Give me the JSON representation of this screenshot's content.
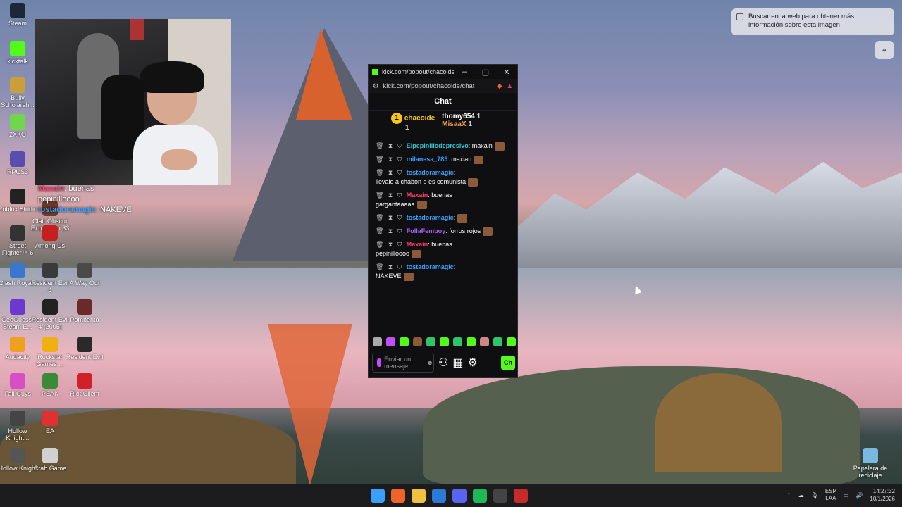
{
  "desktop": {
    "icons": [
      {
        "name": "steam-icon",
        "label": "Steam",
        "color": "#1b2838"
      },
      {
        "name": "kicktalk-icon",
        "label": "kicktalk",
        "color": "#53fc18"
      },
      {
        "name": "bully-icon",
        "label": "Bully Scholarsh...",
        "color": "#c8a03a"
      },
      {
        "name": "2xko-icon",
        "label": "2XKO",
        "color": "#6fd84a"
      },
      {
        "name": "rpcs3-icon",
        "label": "RPCS3",
        "color": "#5b4db0"
      },
      {
        "name": "roblox-studio-icon",
        "label": "Roblox Studio",
        "color": "#222"
      },
      {
        "name": "street-fighter-icon",
        "label": "Street Fighter™ 6",
        "color": "#333"
      },
      {
        "name": "clash-royale-icon",
        "label": "Clash Royale",
        "color": "#3a78d0"
      },
      {
        "name": "geoguessr-icon",
        "label": "GeoGuessr Steam E...",
        "color": "#6a3ad0"
      },
      {
        "name": "audacity-icon",
        "label": "Audacity",
        "color": "#f0a020"
      },
      {
        "name": "fall-guys-icon",
        "label": "Fall Guys",
        "color": "#d64fc4"
      },
      {
        "name": "hollow-knight-icon",
        "label": "Hollow Knight...",
        "color": "#444"
      },
      {
        "name": "hollow-knight-2-icon",
        "label": "Hollow Knight",
        "color": "#555"
      },
      {
        "name": "clair-obscur-icon",
        "label": "Clair Obscur Expedition 33",
        "color": "#6a3a2a"
      },
      {
        "name": "among-us-icon",
        "label": "Among Us",
        "color": "#c42020"
      },
      {
        "name": "resident-evil-4-icon",
        "label": "Resident Evil 4",
        "color": "#3a3a3a"
      },
      {
        "name": "resident-evil-4-2005-icon",
        "label": "Resident Evil 4 (2005)",
        "color": "#222"
      },
      {
        "name": "rockstar-icon",
        "label": "Rockstar Games ...",
        "color": "#f0b010"
      },
      {
        "name": "peak-icon",
        "label": "PEAK",
        "color": "#3a8a3a"
      },
      {
        "name": "ea-icon",
        "label": "EA",
        "color": "#e03030"
      },
      {
        "name": "crab-game-icon",
        "label": "Crab Game",
        "color": "#d0d0d0"
      },
      {
        "name": "a-way-out-icon",
        "label": "A Way Out",
        "color": "#4a4a4a"
      },
      {
        "name": "pomberito-icon",
        "label": "Pomberito",
        "color": "#6a2a2a"
      },
      {
        "name": "resident-evil-icon",
        "label": "Resident Evil",
        "color": "#2a2a2a"
      },
      {
        "name": "riot-client-icon",
        "label": "Riot Client",
        "color": "#d0202a"
      },
      {
        "name": "recycle-bin-icon",
        "label": "Papelera de reciclaje",
        "color": "#7ab8e0"
      }
    ]
  },
  "overlay_chat": {
    "line1_name": "Maxain",
    "line1_text": ": buenas",
    "line2_text": "pepinilloooo",
    "line3_name": "tostadoramagic",
    "line3_text": ": NAKEVE"
  },
  "browser": {
    "title": "kick.com/popout/chacoide/...",
    "url": "kick.com/popout/chacoide/chat",
    "chat_title": "Chat",
    "leaders": [
      {
        "name": "chacoide",
        "count": "1",
        "rank": "1"
      },
      {
        "name": "thomy654",
        "count": "1"
      },
      {
        "name": "MisaaX",
        "count": "1"
      }
    ],
    "messages": [
      {
        "user": "Elpepinillodepresivo",
        "text": ": maxain",
        "color_class": "u-cyan"
      },
      {
        "user": "milanesa_785",
        "text": ": maxian",
        "color_class": "u-blue"
      },
      {
        "user": "tostadoramagic",
        "text": ":",
        "line2": "llevalo a chabon q es comunista",
        "color_class": "u-blue"
      },
      {
        "user": "Maxain",
        "text": ": buenas",
        "line2": "gargantaaaaa",
        "color_class": "u-red"
      },
      {
        "user": "tostadoramagic",
        "text": ":",
        "color_class": "u-blue"
      },
      {
        "user": "FollaFemboy",
        "text": ": forros rojos",
        "color_class": "u-purple"
      },
      {
        "user": "Maxain",
        "text": ": buenas",
        "line2": "pepinilloooo",
        "color_class": "u-red"
      },
      {
        "user": "tostadoramagic",
        "text": ":",
        "line2": "NAKEVE",
        "color_class": "u-blue"
      }
    ],
    "input_placeholder": "Enviar un mensaje",
    "send_label": "Ch"
  },
  "lens": {
    "text": "Buscar en la web para obtener más información sobre esta imagen"
  },
  "taskbar": {
    "lang1": "ESP",
    "lang2": "LAA",
    "time": "14:27:32",
    "date": "10/1/2026"
  }
}
